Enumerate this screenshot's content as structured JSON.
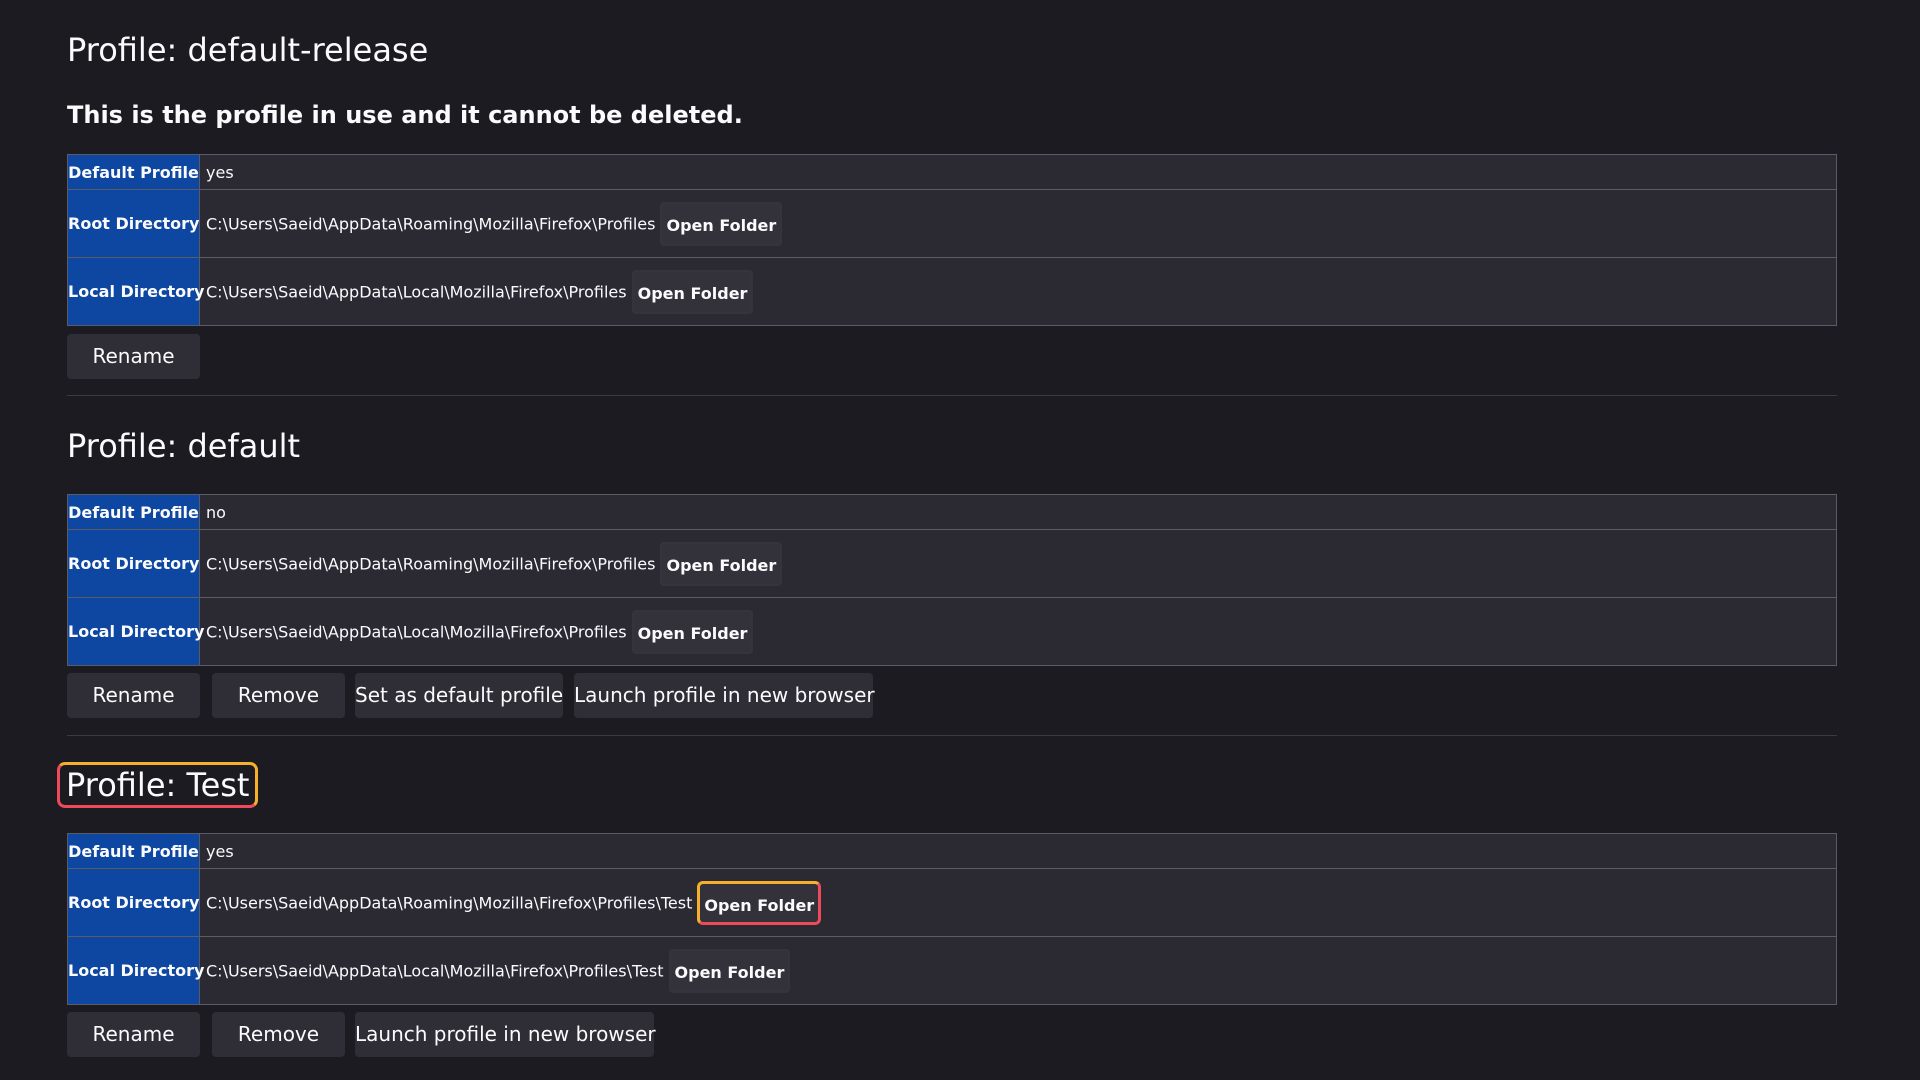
{
  "profiles": [
    {
      "title": "Profile: default-release",
      "notice": "This is the profile in use and it cannot be deleted.",
      "rows": [
        {
          "label": "Default Profile",
          "value": "yes"
        },
        {
          "label": "Root Directory",
          "value": "C:\\Users\\Saeid\\AppData\\Roaming\\Mozilla\\Firefox\\Profiles",
          "button": "Open Folder"
        },
        {
          "label": "Local Directory",
          "value": "C:\\Users\\Saeid\\AppData\\Local\\Mozilla\\Firefox\\Profiles",
          "button": "Open Folder"
        }
      ],
      "actions": [
        "Rename"
      ]
    },
    {
      "title": "Profile: default",
      "rows": [
        {
          "label": "Default Profile",
          "value": "no"
        },
        {
          "label": "Root Directory",
          "value": "C:\\Users\\Saeid\\AppData\\Roaming\\Mozilla\\Firefox\\Profiles",
          "button": "Open Folder"
        },
        {
          "label": "Local Directory",
          "value": "C:\\Users\\Saeid\\AppData\\Local\\Mozilla\\Firefox\\Profiles",
          "button": "Open Folder"
        }
      ],
      "actions": [
        "Rename",
        "Remove",
        "Set as default profile",
        "Launch profile in new browser"
      ]
    },
    {
      "title": "Profile: Test",
      "rows": [
        {
          "label": "Default Profile",
          "value": "yes"
        },
        {
          "label": "Root Directory",
          "value": "C:\\Users\\Saeid\\AppData\\Roaming\\Mozilla\\Firefox\\Profiles\\Test",
          "button": "Open Folder"
        },
        {
          "label": "Local Directory",
          "value": "C:\\Users\\Saeid\\AppData\\Local\\Mozilla\\Firefox\\Profiles\\Test",
          "button": "Open Folder"
        }
      ],
      "actions": [
        "Rename",
        "Remove",
        "Launch profile in new browser"
      ]
    }
  ],
  "colors": {
    "background": "#1c1b22",
    "key_cell": "#0d47a1",
    "highlight_start": "#ef4a5a",
    "highlight_end": "#f7b02c"
  }
}
